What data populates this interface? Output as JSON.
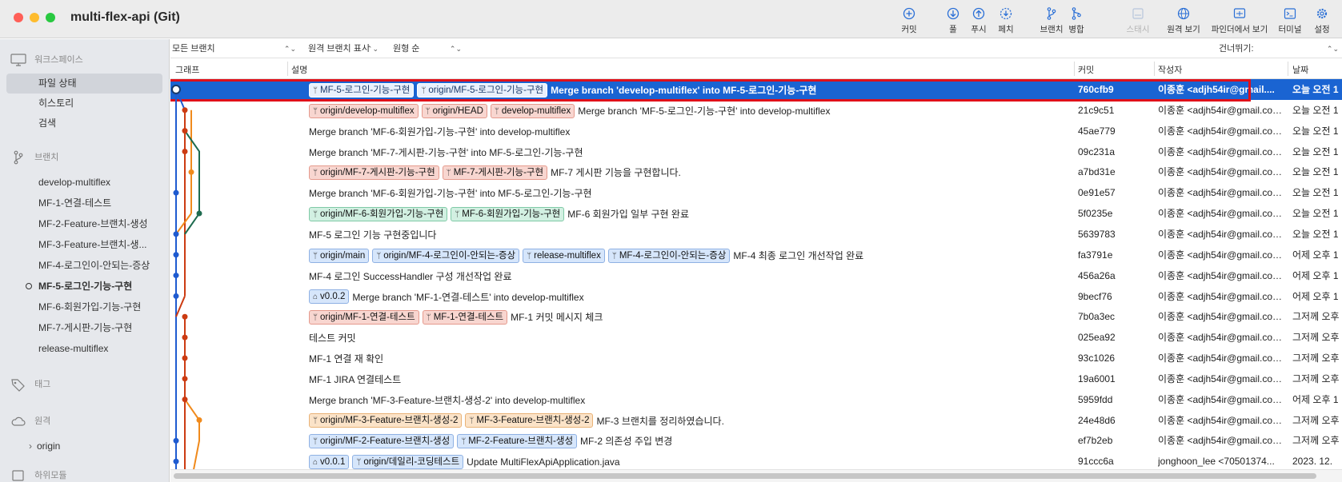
{
  "window": {
    "title": "multi-flex-api (Git)",
    "traffic_lights": [
      "#ff5f57",
      "#febc2e",
      "#28c840"
    ]
  },
  "toolbar": {
    "commit": "커밋",
    "pull": "풀",
    "push": "푸시",
    "fetch": "페치",
    "branch": "브랜치",
    "merge": "병합",
    "stash": "스태시",
    "remote": "원격 보기",
    "finder": "파인더에서 보기",
    "terminal": "터미널",
    "settings": "설정"
  },
  "sidebar": {
    "workspace": "워크스페이스",
    "workspace_items": [
      "파일 상태",
      "히스토리",
      "검색"
    ],
    "branches_label": "브랜치",
    "branches": [
      "develop-multiflex",
      "MF-1-연결-테스트",
      "MF-2-Feature-브랜치-생성",
      "MF-3-Feature-브랜치-생...",
      "MF-4-로그인이-안되는-증상",
      "MF-5-로그인-기능-구현",
      "MF-6-회원가입-기능-구현",
      "MF-7-게시판-기능-구현",
      "release-multiflex"
    ],
    "tags_label": "태그",
    "remotes_label": "원격",
    "remote_item": "origin",
    "remote_chevron": "›",
    "submodules_label": "하위모듈"
  },
  "filters": {
    "branches": "모든 브랜치",
    "remote": "원격 브랜치 표시",
    "order": "원형 순",
    "jump": "건너뛰기:"
  },
  "columns": {
    "graph": "그래프",
    "description": "설명",
    "commit": "커밋",
    "author": "작성자",
    "date": "날짜"
  },
  "commits": [
    {
      "refs": [
        {
          "name": "MF-5-로그인-기능-구현",
          "kind": "blue"
        },
        {
          "name": "origin/MF-5-로그인-기능-구현",
          "kind": "blue"
        }
      ],
      "message": "Merge branch 'develop-multiflex' into MF-5-로그인-기능-구현",
      "hash": "760cfb9",
      "author": "이종훈 <adjh54ir@gmail....",
      "date": "오늘 오전 1"
    },
    {
      "refs": [
        {
          "name": "origin/develop-multiflex",
          "kind": "red"
        },
        {
          "name": "origin/HEAD",
          "kind": "red"
        },
        {
          "name": "develop-multiflex",
          "kind": "red"
        }
      ],
      "message": "Merge branch 'MF-5-로그인-기능-구현' into develop-multiflex",
      "hash": "21c9c51",
      "author": "이종훈 <adjh54ir@gmail.com>",
      "date": "오늘 오전 1"
    },
    {
      "refs": [],
      "message": "Merge branch 'MF-6-회원가입-기능-구현' into develop-multiflex",
      "hash": "45ae779",
      "author": "이종훈 <adjh54ir@gmail.com>",
      "date": "오늘 오전 1"
    },
    {
      "refs": [],
      "message": "Merge branch 'MF-7-게시판-기능-구현' into MF-5-로그인-기능-구현",
      "hash": "09c231a",
      "author": "이종훈 <adjh54ir@gmail.com>",
      "date": "오늘 오전 1"
    },
    {
      "refs": [
        {
          "name": "origin/MF-7-게시판-기능-구현",
          "kind": "red"
        },
        {
          "name": "MF-7-게시판-기능-구현",
          "kind": "red"
        }
      ],
      "message": "MF-7 게시판 기능을 구현합니다.",
      "hash": "a7bd31e",
      "author": "이종훈 <adjh54ir@gmail.com>",
      "date": "오늘 오전 1"
    },
    {
      "refs": [],
      "message": "Merge branch 'MF-6-회원가입-기능-구현' into MF-5-로그인-기능-구현",
      "hash": "0e91e57",
      "author": "이종훈 <adjh54ir@gmail.com>",
      "date": "오늘 오전 1"
    },
    {
      "refs": [
        {
          "name": "origin/MF-6-회원가입-기능-구현",
          "kind": "green"
        },
        {
          "name": "MF-6-회원가입-기능-구현",
          "kind": "green"
        }
      ],
      "message": "MF-6 회원가입 일부 구현 완료",
      "hash": "5f0235e",
      "author": "이종훈 <adjh54ir@gmail.com>",
      "date": "오늘 오전 1"
    },
    {
      "refs": [],
      "message": "MF-5 로그인 기능 구현중입니다",
      "hash": "5639783",
      "author": "이종훈 <adjh54ir@gmail.com>",
      "date": "오늘 오전 1"
    },
    {
      "refs": [
        {
          "name": "origin/main",
          "kind": "blue"
        },
        {
          "name": "origin/MF-4-로그인이-안되는-증상",
          "kind": "blue"
        },
        {
          "name": "release-multiflex",
          "kind": "blue"
        },
        {
          "name": "MF-4-로그인이-안되는-증상",
          "kind": "blue"
        }
      ],
      "message": "MF-4 최종 로그인 개선작업 완료",
      "hash": "fa3791e",
      "author": "이종훈 <adjh54ir@gmail.com>",
      "date": "어제 오후 1"
    },
    {
      "refs": [],
      "message": "MF-4 로그인 SuccessHandler 구성 개선작업 완료",
      "hash": "456a26a",
      "author": "이종훈 <adjh54ir@gmail.com>",
      "date": "어제 오후 1"
    },
    {
      "refs": [
        {
          "name": "v0.0.2",
          "kind": "tag"
        }
      ],
      "message": "Merge branch 'MF-1-연결-테스트' into develop-multiflex",
      "hash": "9becf76",
      "author": "이종훈 <adjh54ir@gmail.com>",
      "date": "어제 오후 1"
    },
    {
      "refs": [
        {
          "name": "origin/MF-1-연결-테스트",
          "kind": "red"
        },
        {
          "name": "MF-1-연결-테스트",
          "kind": "red"
        }
      ],
      "message": "MF-1 커밋 메시지 체크",
      "hash": "7b0a3ec",
      "author": "이종훈 <adjh54ir@gmail.com>",
      "date": "그저께 오후"
    },
    {
      "refs": [],
      "message": "테스트 커밋",
      "hash": "025ea92",
      "author": "이종훈 <adjh54ir@gmail.com>",
      "date": "그저께 오후"
    },
    {
      "refs": [],
      "message": "MF-1 연결 재 확인",
      "hash": "93c1026",
      "author": "이종훈 <adjh54ir@gmail.com>",
      "date": "그저께 오후"
    },
    {
      "refs": [],
      "message": "MF-1 JIRA 연결테스트",
      "hash": "19a6001",
      "author": "이종훈 <adjh54ir@gmail.com>",
      "date": "그저께 오후"
    },
    {
      "refs": [],
      "message": "Merge branch 'MF-3-Feature-브랜치-생성-2' into develop-multiflex",
      "hash": "5959fdd",
      "author": "이종훈 <adjh54ir@gmail.com>",
      "date": "어제 오후 1"
    },
    {
      "refs": [
        {
          "name": "origin/MF-3-Feature-브랜치-생성-2",
          "kind": "orange"
        },
        {
          "name": "MF-3-Feature-브랜치-생성-2",
          "kind": "orange"
        }
      ],
      "message": "MF-3 브랜치를 정리하였습니다.",
      "hash": "24e48d6",
      "author": "이종훈 <adjh54ir@gmail.com>",
      "date": "그저께 오후"
    },
    {
      "refs": [
        {
          "name": "origin/MF-2-Feature-브랜치-생성",
          "kind": "blue"
        },
        {
          "name": "MF-2-Feature-브랜치-생성",
          "kind": "blue"
        }
      ],
      "message": "MF-2 의존성 주입 변경",
      "hash": "ef7b2eb",
      "author": "이종훈 <adjh54ir@gmail.com>",
      "date": "그저께 오후"
    },
    {
      "refs": [
        {
          "name": "v0.0.1",
          "kind": "tag"
        },
        {
          "name": "origin/데일리-코딩테스트",
          "kind": "blue"
        }
      ],
      "message": "Update MultiFlexApiApplication.java",
      "hash": "91ccc6a",
      "author": "jonghoon_lee <70501374...",
      "date": "2023. 12."
    }
  ]
}
